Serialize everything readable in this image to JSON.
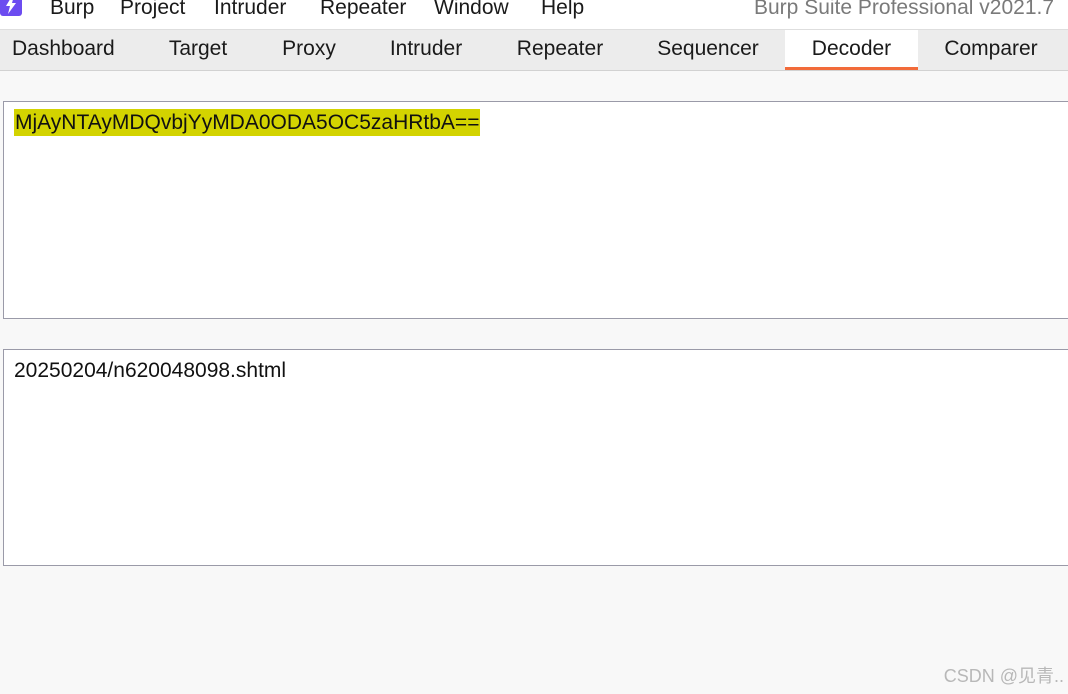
{
  "menubar": {
    "app_icon": "burp-lightning-icon",
    "items": [
      "Burp",
      "Project",
      "Intruder",
      "Repeater",
      "Window",
      "Help"
    ],
    "app_title": "Burp Suite Professional v2021.7"
  },
  "tabs": {
    "items": [
      "Dashboard",
      "Target",
      "Proxy",
      "Intruder",
      "Repeater",
      "Sequencer",
      "Decoder",
      "Comparer"
    ],
    "active": "Decoder"
  },
  "decoder": {
    "input_text": "MjAyNTAyMDQvbjYyMDA0ODA5OC5zaHRtbA==",
    "output_text": "20250204/n620048098.shtml"
  },
  "watermark": "CSDN @见青..",
  "colors": {
    "active_tab_underline": "#f26b3a",
    "selection_highlight": "#d3d300",
    "app_icon": "#6c4cf0"
  }
}
